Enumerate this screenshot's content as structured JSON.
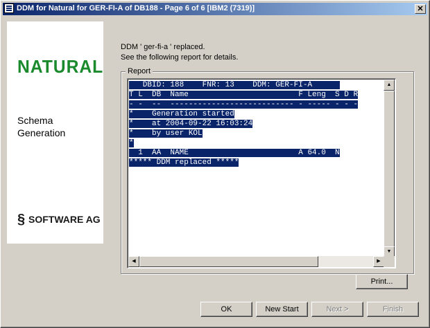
{
  "window": {
    "title": "DDM for Natural for GER-FI-A of DB188 - Page 6 of 6 [IBM2 (7319)]",
    "close_glyph": "✕"
  },
  "left_panel": {
    "natural_logo": "NATURAL",
    "schema_line1": "Schema",
    "schema_line2": "Generation",
    "software_ag_logo": "SOFTWARE AG"
  },
  "message": {
    "line1": "DDM ' ger-fi-a ' replaced.",
    "line2": "See the following report for details."
  },
  "report": {
    "label": "Report",
    "lines": [
      "   DBID: 188    FNR: 13    DDM: GER-FI-A      ",
      "T L  DB  Name                        F Leng  S D R",
      "- -  --  --------------------------- - ----- - - -",
      "*    Generation started",
      "*    at 2004-09-22 16:03:24",
      "*    by user KOL",
      "*",
      "  1  AA  NAME                        A 64.0  N",
      "***** DDM replaced *****"
    ]
  },
  "buttons": {
    "print": "Print...",
    "ok": "OK",
    "new_start": "New Start",
    "next": "Next >",
    "finish": "Finish"
  }
}
